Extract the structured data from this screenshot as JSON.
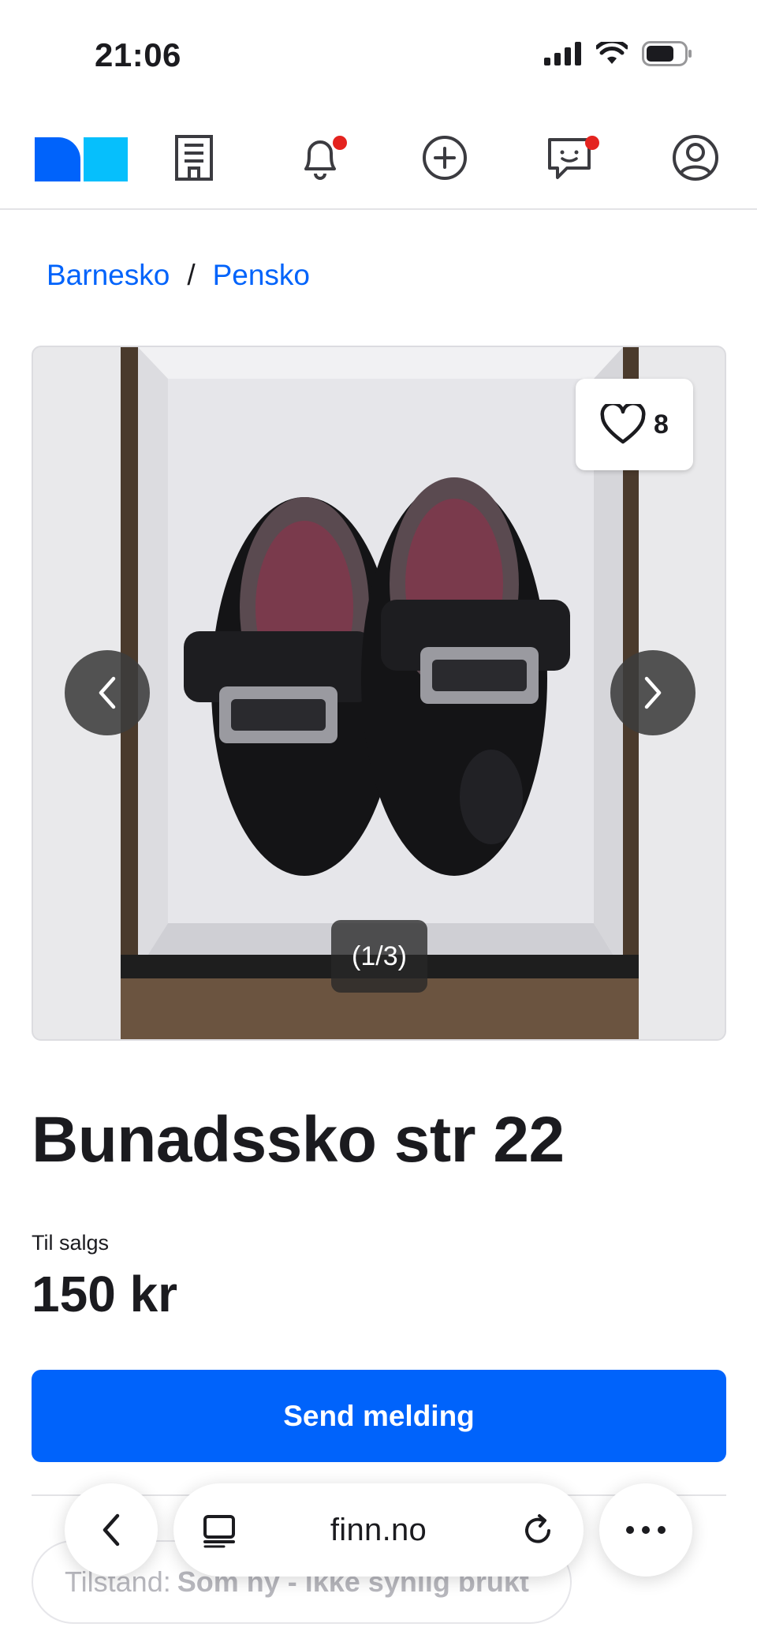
{
  "status_bar": {
    "time": "21:06"
  },
  "nav": {
    "icons": [
      "building-icon",
      "bell-icon",
      "plus-circle-icon",
      "chat-icon",
      "profile-icon"
    ],
    "notification_color": "#e4231f"
  },
  "breadcrumb": {
    "items": [
      "Barnesko",
      "Pensko"
    ],
    "separator": "/"
  },
  "gallery": {
    "favorite_count": "8",
    "counter": "(1/3)"
  },
  "listing": {
    "title": "Bunadssko str 22",
    "sale_label": "Til salgs",
    "price": "150 kr"
  },
  "actions": {
    "send_label": "Send melding"
  },
  "details": {
    "condition_prefix": "Tilstand:",
    "condition_value": "Som ny - ikke synlig brukt"
  },
  "browser": {
    "url": "finn.no"
  },
  "colors": {
    "accent": "#0063fb",
    "logo_dark": "#0063fb",
    "logo_light": "#06bffc"
  }
}
